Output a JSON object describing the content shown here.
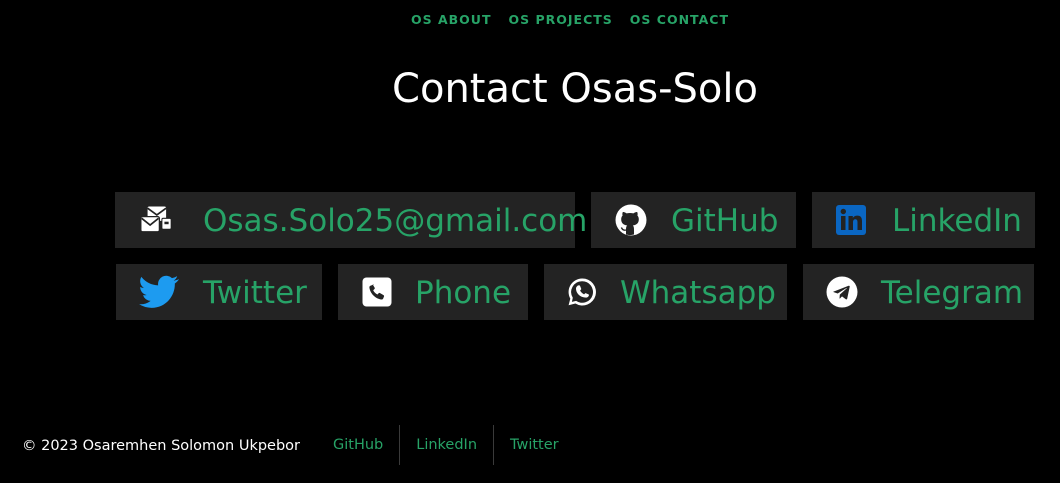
{
  "nav": {
    "items": [
      {
        "label": "OS ABOUT"
      },
      {
        "label": "OS PROJECTS"
      },
      {
        "label": "OS CONTACT"
      }
    ]
  },
  "page": {
    "title": "Contact Osas-Solo"
  },
  "contacts": {
    "email": {
      "label": "Osas.Solo25@gmail.com",
      "icon": "email-envelopes-icon"
    },
    "github": {
      "label": "GitHub",
      "icon": "github-icon"
    },
    "linkedin": {
      "label": "LinkedIn",
      "icon": "linkedin-icon"
    },
    "twitter": {
      "label": "Twitter",
      "icon": "twitter-icon"
    },
    "phone": {
      "label": "Phone",
      "icon": "phone-icon"
    },
    "whatsapp": {
      "label": "Whatsapp",
      "icon": "whatsapp-icon"
    },
    "telegram": {
      "label": "Telegram",
      "icon": "telegram-icon"
    }
  },
  "footer": {
    "copyright": "© 2023 Osaremhen Solomon Ukpebor",
    "links": [
      {
        "label": "GitHub"
      },
      {
        "label": "LinkedIn"
      },
      {
        "label": "Twitter"
      }
    ]
  },
  "colors": {
    "background": "#000000",
    "accent": "#27a367",
    "card": "#232323",
    "text": "#ffffff",
    "twitter_blue": "#1d9bf0",
    "linkedin_blue": "#0a66c2"
  }
}
